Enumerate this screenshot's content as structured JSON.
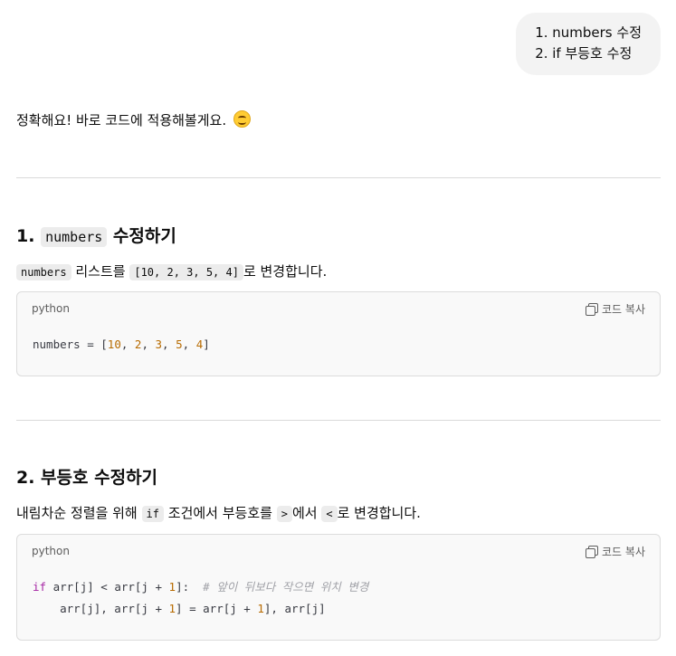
{
  "user_message": {
    "line1": "1. numbers 수정",
    "line2": "2. if 부등호 수정"
  },
  "intro": {
    "text": "정확해요! 바로 코드에 적용해볼게요.",
    "emoji": "smiling-face"
  },
  "section1": {
    "heading_prefix": "1.",
    "heading_code": "numbers",
    "heading_suffix": "수정하기",
    "desc_code1": "numbers",
    "desc_text1": "리스트를",
    "desc_code2": "[10, 2, 3, 5, 4]",
    "desc_text2": "로 변경합니다.",
    "code_lang": "python",
    "copy_label": "코드 복사",
    "code": {
      "t1": "numbers = [",
      "n1": "10",
      "t2": ", ",
      "n2": "2",
      "t3": ", ",
      "n3": "3",
      "t4": ", ",
      "n4": "5",
      "t5": ", ",
      "n5": "4",
      "t6": "]"
    }
  },
  "section2": {
    "heading": "2. 부등호 수정하기",
    "desc_text1": "내림차순 정렬을 위해",
    "desc_code1": "if",
    "desc_text2": "조건에서 부등호를",
    "desc_code2": ">",
    "desc_text3": "에서",
    "desc_code3": "<",
    "desc_text4": "로 변경합니다.",
    "code_lang": "python",
    "copy_label": "코드 복사",
    "code": {
      "l1_kw": "if",
      "l1_a": " arr[j] < arr[j + ",
      "l1_n": "1",
      "l1_b": "]:  ",
      "l1_cm": "# 앞이 뒤보다 작으면 위치 변경",
      "l2_a": "    arr[j], arr[j + ",
      "l2_n1": "1",
      "l2_b": "] = arr[j + ",
      "l2_n2": "1",
      "l2_c": "], arr[j]"
    }
  }
}
